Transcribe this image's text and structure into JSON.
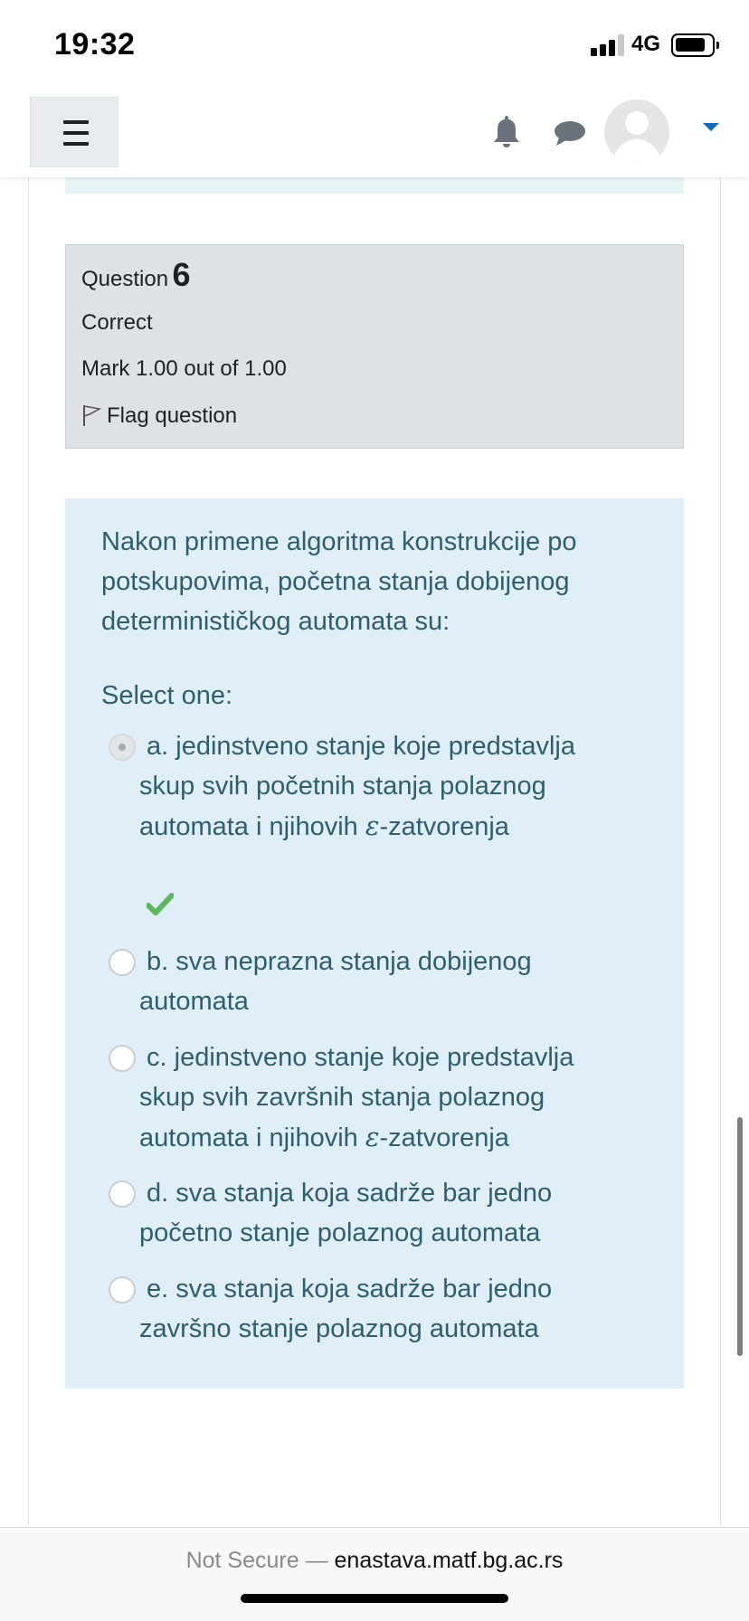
{
  "status_bar": {
    "time": "19:32",
    "network": "4G"
  },
  "navbar": {
    "menu_icon": "hamburger-icon",
    "notification_icon": "bell-icon",
    "messages_icon": "chat-bubble-icon",
    "user_menu_icon": "chevron-down-icon",
    "accent_color": "#0f6cbf"
  },
  "question": {
    "label": "Question",
    "number": "6",
    "state": "Correct",
    "grade": "Mark 1.00 out of 1.00",
    "flag_label": "Flag question",
    "text": "Nakon primene algoritma konstrukcije po potskupovima, početna stanja dobijenog determinističkog automata su:",
    "prompt": "Select one:",
    "answers": [
      {
        "letter": "a.",
        "first": "jedinstveno stanje koje predstavlja",
        "rest": "skup svih početnih stanja polaznog automata i njihovih ",
        "eps": "ε",
        "tail": "-zatvorenja",
        "checked": true,
        "feedback_icon": "checkmark-icon"
      },
      {
        "letter": "b.",
        "first": "sva neprazna stanja dobijenog",
        "rest": "automata",
        "checked": false
      },
      {
        "letter": "c.",
        "first": "jedinstveno stanje koje predstavlja",
        "rest": "skup svih završnih stanja polaznog automata i njihovih ",
        "eps": "ε",
        "tail": "-zatvorenja",
        "checked": false
      },
      {
        "letter": "d.",
        "first": "sva stanja koja sadrže bar jedno",
        "rest": "početno stanje polaznog automata",
        "checked": false
      },
      {
        "letter": "e.",
        "first": "sva stanja koja sadrže bar jedno",
        "rest": "završno stanje polaznog automata",
        "checked": false
      }
    ],
    "colors": {
      "correct": "#5cb85c",
      "panel": "#e0eff7",
      "info": "#dee2e6"
    }
  },
  "browser": {
    "not_secure": "Not Secure —",
    "host": "enastava.matf.bg.ac.rs"
  }
}
